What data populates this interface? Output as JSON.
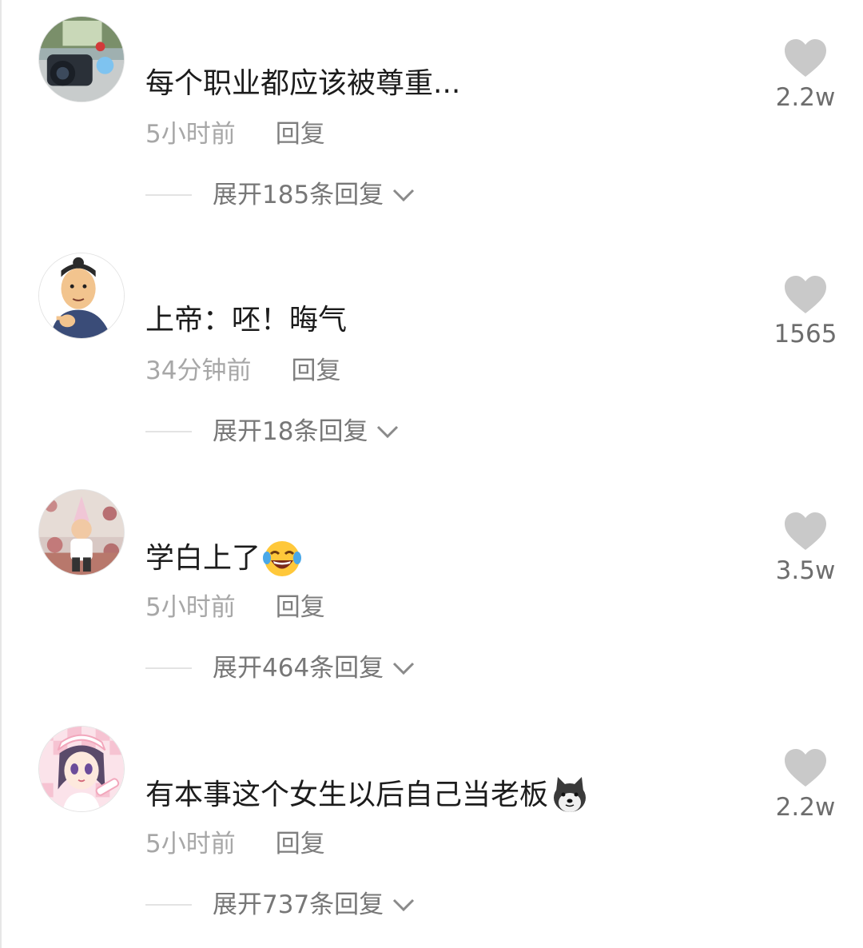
{
  "comments": [
    {
      "text": "每个职业都应该被尊重...",
      "time": "5小时前",
      "reply_label": "回复",
      "expand_label": "展开185条回复",
      "likes": "2.2w",
      "avatar_icon": "camera-desk-avatar",
      "emoji_icon": ""
    },
    {
      "text": "上帝：呸！晦气",
      "time": "34分钟前",
      "reply_label": "回复",
      "expand_label": "展开18条回复",
      "likes": "1565",
      "avatar_icon": "cartoon-man-pointing-avatar",
      "emoji_icon": ""
    },
    {
      "text": "学白上了",
      "time": "5小时前",
      "reply_label": "回复",
      "expand_label": "展开464条回复",
      "likes": "3.5w",
      "avatar_icon": "child-party-hat-avatar",
      "emoji_icon": "tears-of-joy-emoji"
    },
    {
      "text": "有本事这个女生以后自己当老板",
      "time": "5小时前",
      "reply_label": "回复",
      "expand_label": "展开737条回复",
      "likes": "2.2w",
      "avatar_icon": "anime-nurse-girl-avatar",
      "emoji_icon": "shiba-dog-emoji"
    }
  ],
  "colors": {
    "text": "#1c1c1c",
    "meta": "#a7a7a7",
    "reply": "#7e7e7e",
    "heart": "#c9c9c9"
  }
}
